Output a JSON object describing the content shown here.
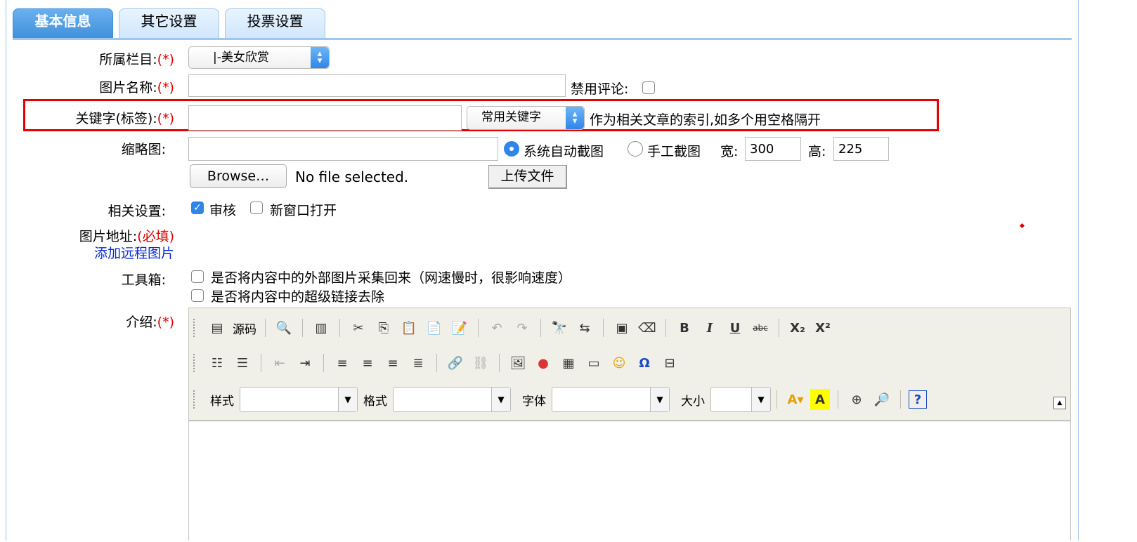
{
  "tabs": [
    {
      "label": "基本信息",
      "active": true
    },
    {
      "label": "其它设置",
      "active": false
    },
    {
      "label": "投票设置",
      "active": false
    }
  ],
  "form": {
    "category": {
      "label": "所属栏目:",
      "required": "(*)",
      "value": "|-美女欣赏"
    },
    "title": {
      "label": "图片名称:",
      "required": "(*)",
      "value": "",
      "disable_comment_label": "禁用评论:"
    },
    "keywords": {
      "label": "关键字(标签):",
      "required": "(*)",
      "value": "",
      "select_value": "常用关键字",
      "hint": "作为相关文章的索引,如多个用空格隔开"
    },
    "thumbnail": {
      "label": "缩略图:",
      "value": "",
      "auto_crop_label": "系统自动截图",
      "manual_crop_label": "手工截图",
      "width_label": "宽:",
      "width_value": "300",
      "height_label": "高:",
      "height_value": "225",
      "browse_label": "Browse…",
      "file_status": "No file selected.",
      "upload_label": "上传文件"
    },
    "settings": {
      "label": "相关设置:",
      "audit_label": "审核",
      "new_window_label": "新窗口打开"
    },
    "image_url": {
      "label": "图片地址:",
      "required": "(必填)",
      "add_remote_label": "添加远程图片"
    },
    "toolbox": {
      "label": "工具箱:",
      "collect_images_label": "是否将内容中的外部图片采集回来（网速慢时，很影响速度）",
      "remove_links_label": "是否将内容中的超级链接去除"
    },
    "intro": {
      "label": "介绍:",
      "required": "(*)"
    }
  },
  "editor": {
    "source_label": "源码",
    "style_label": "样式",
    "format_label": "格式",
    "font_label": "字体",
    "size_label": "大小",
    "bold": "B",
    "italic": "I",
    "underline": "U",
    "strike": "abc",
    "subscript": "X₂",
    "superscript": "X²",
    "help": "?"
  },
  "colors": {
    "accent": "#2f86e8",
    "highlight_box": "#e60000",
    "required": "#e00000",
    "link": "#0a2bd4"
  }
}
